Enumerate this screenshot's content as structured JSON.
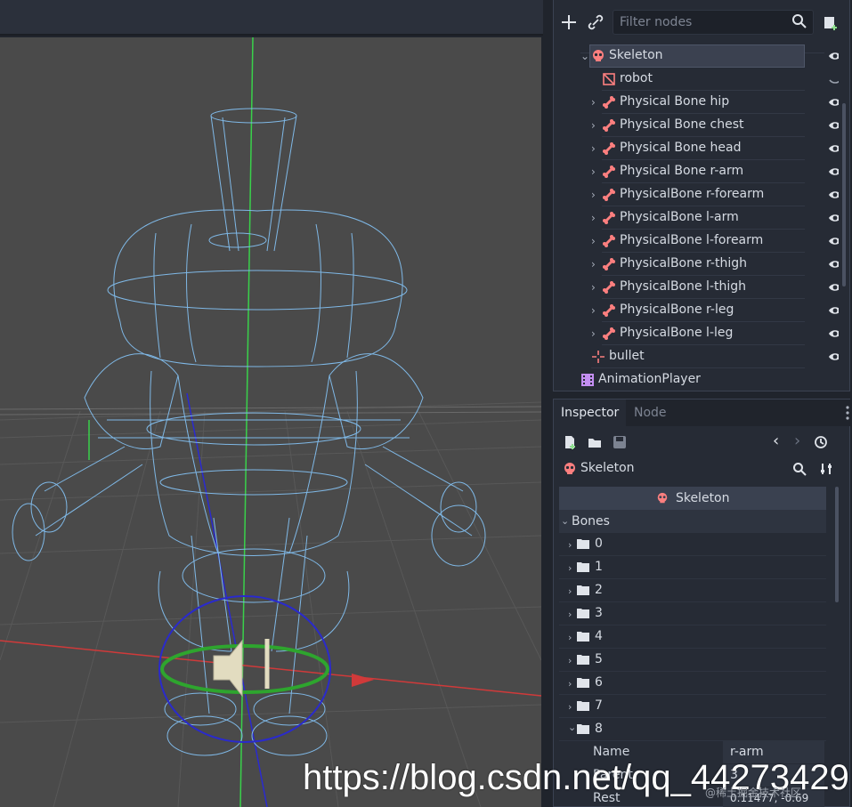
{
  "scene_tree": {
    "filter_placeholder": "Filter nodes",
    "nodes": [
      {
        "label": "Skeleton",
        "icon": "skeleton-icon"
      },
      {
        "label": "robot",
        "icon": "mesh-icon"
      },
      {
        "label": "Physical Bone hip",
        "icon": "bone-icon"
      },
      {
        "label": "Physical Bone chest",
        "icon": "bone-icon"
      },
      {
        "label": "Physical Bone head",
        "icon": "bone-icon"
      },
      {
        "label": "Physical Bone r-arm",
        "icon": "bone-icon"
      },
      {
        "label": "PhysicalBone r-forearm",
        "icon": "bone-icon"
      },
      {
        "label": "PhysicalBone l-arm",
        "icon": "bone-icon"
      },
      {
        "label": "PhysicalBone l-forearm",
        "icon": "bone-icon"
      },
      {
        "label": "PhysicalBone r-thigh",
        "icon": "bone-icon"
      },
      {
        "label": "PhysicalBone l-thigh",
        "icon": "bone-icon"
      },
      {
        "label": "PhysicalBone r-leg",
        "icon": "bone-icon"
      },
      {
        "label": "PhysicalBone l-leg",
        "icon": "bone-icon"
      },
      {
        "label": "bullet",
        "icon": "position-icon"
      },
      {
        "label": "AnimationPlayer",
        "icon": "animation-icon"
      }
    ]
  },
  "inspector": {
    "tabs": [
      "Inspector",
      "Node"
    ],
    "object_name": "Skeleton",
    "header": "Skeleton",
    "section": "Bones",
    "bones": [
      "0",
      "1",
      "2",
      "3",
      "4",
      "5",
      "6",
      "7",
      "8"
    ],
    "properties": [
      {
        "name": "Name",
        "value": "r-arm"
      },
      {
        "name": "Parent",
        "value": "3"
      },
      {
        "name": "Rest",
        "value": "0.11477, -0.69"
      }
    ]
  },
  "watermark": {
    "url": "https://blog.csdn.net/qq_44273429",
    "small": "@稀土掘金技术社区"
  },
  "colors": {
    "bg_dark": "#20242c",
    "panel": "#262b35",
    "accent_pink": "#fc7f7f",
    "viewport_gray": "#4a4a4a",
    "wire_blue": "#7fb8e6"
  }
}
